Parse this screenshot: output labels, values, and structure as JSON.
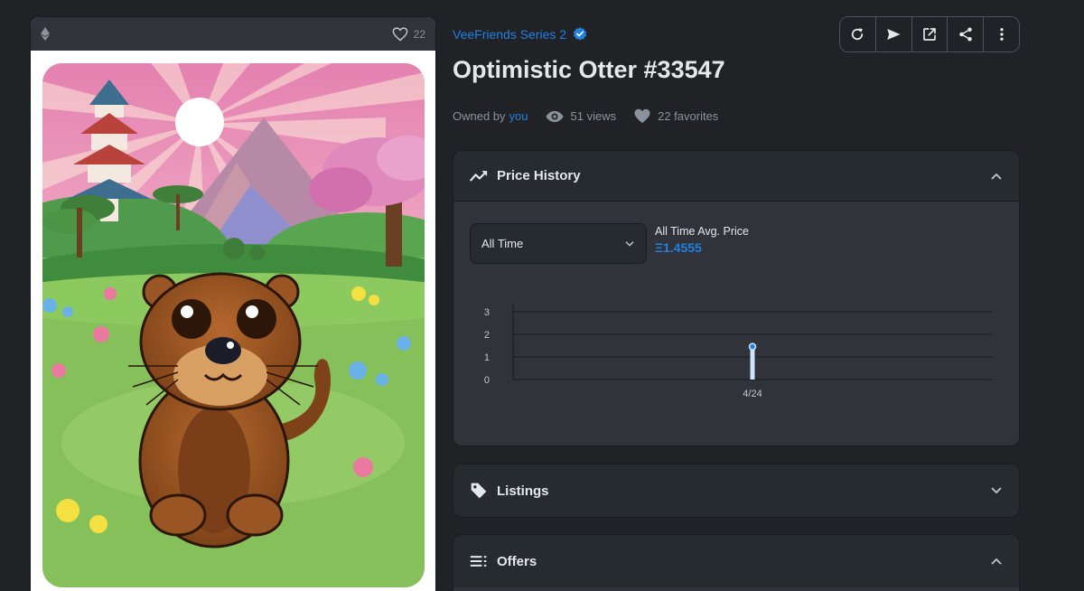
{
  "media": {
    "favorite_count": "22"
  },
  "collection": {
    "name": "VeeFriends Series 2"
  },
  "item": {
    "title": "Optimistic Otter #33547"
  },
  "meta": {
    "owned_by_label": "Owned by",
    "owner": "you",
    "views": "51 views",
    "favorites": "22 favorites"
  },
  "toolbar": {
    "icons": [
      "refresh-icon",
      "transfer-send-icon",
      "external-link-icon",
      "share-icon",
      "more-vertical-icon"
    ]
  },
  "price_history": {
    "title": "Price History",
    "time_filter": "All Time",
    "avg_label": "All Time Avg. Price",
    "avg_value": "Ξ1.4555"
  },
  "chart_data": {
    "type": "bar",
    "categories": [
      "4/24"
    ],
    "values": [
      1.4555
    ],
    "ylim": [
      0,
      3
    ],
    "yticks": [
      "0",
      "1",
      "2",
      "3"
    ],
    "grid": true,
    "colors": {
      "bar": "#cfe4fb",
      "point": "#2081e2",
      "grid": "#151b22"
    }
  },
  "listings": {
    "title": "Listings"
  },
  "offers": {
    "title": "Offers"
  },
  "colors": {
    "background": "#202225",
    "panel": "#303339",
    "accent": "#2081e2",
    "muted_text": "#8a939b"
  }
}
